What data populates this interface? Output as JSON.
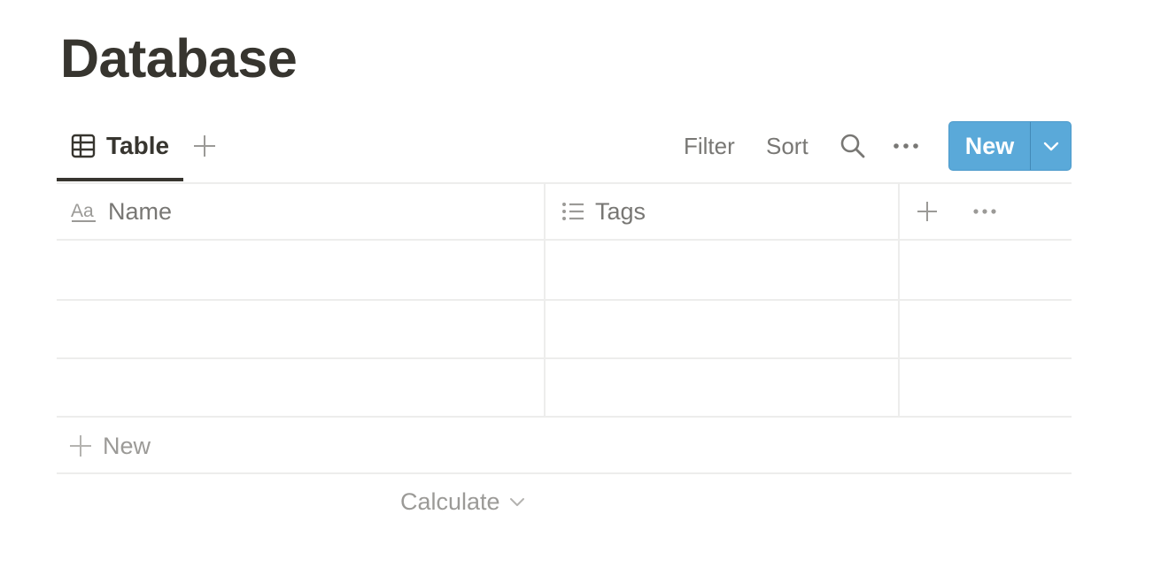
{
  "page": {
    "title": "Database"
  },
  "view_bar": {
    "tabs": [
      {
        "label": "Table",
        "icon": "table-icon",
        "active": true
      }
    ],
    "add_view_icon": "plus-icon",
    "actions": {
      "filter_label": "Filter",
      "sort_label": "Sort",
      "search_icon": "search-icon",
      "more_icon": "more-icon"
    },
    "new_button": {
      "label": "New",
      "dropdown_icon": "chevron-down-icon",
      "color": "#5aa9d9"
    }
  },
  "table": {
    "columns": [
      {
        "label": "Name",
        "icon": "text-property-icon"
      },
      {
        "label": "Tags",
        "icon": "list-property-icon"
      }
    ],
    "add_property_icon": "plus-icon",
    "property_more_icon": "more-icon",
    "rows": [
      {
        "name": "",
        "tags": ""
      },
      {
        "name": "",
        "tags": ""
      },
      {
        "name": "",
        "tags": ""
      }
    ],
    "new_row_label": "New",
    "calculate_label": "Calculate"
  }
}
